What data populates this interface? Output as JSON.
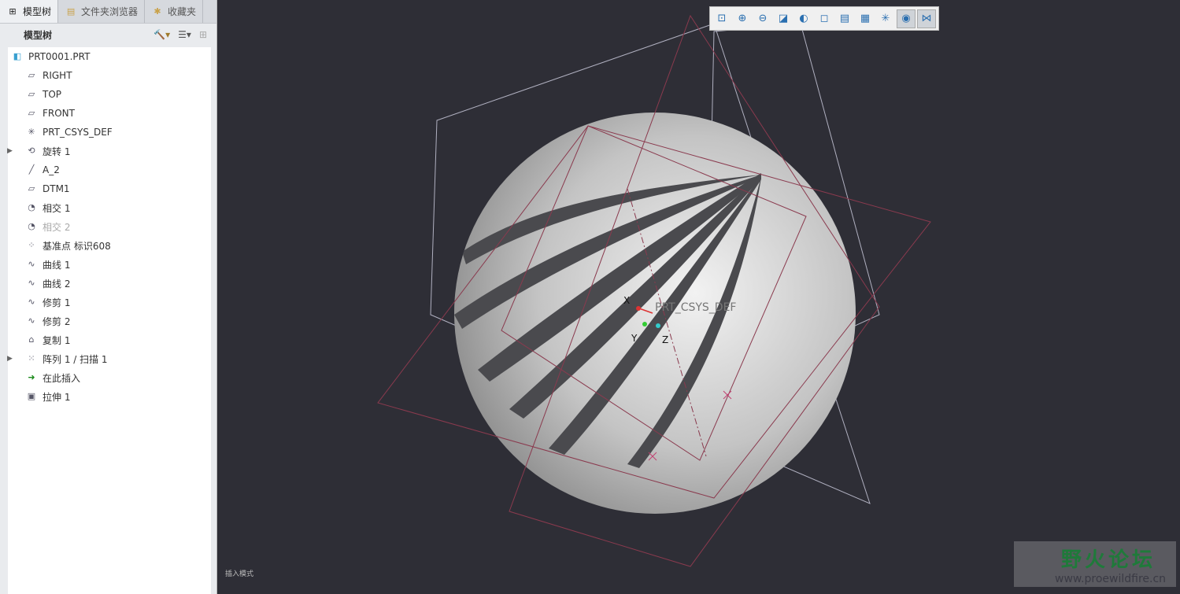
{
  "tabs": [
    {
      "label": "模型树",
      "icon": "model-tree-icon"
    },
    {
      "label": "文件夹浏览器",
      "icon": "folder-icon"
    },
    {
      "label": "收藏夹",
      "icon": "favorites-icon"
    }
  ],
  "panel_title": "模型树",
  "tree": [
    {
      "label": "PRT0001.PRT",
      "icon": "part-icon"
    },
    {
      "label": "RIGHT",
      "icon": "datum-plane-icon"
    },
    {
      "label": "TOP",
      "icon": "datum-plane-icon"
    },
    {
      "label": "FRONT",
      "icon": "datum-plane-icon"
    },
    {
      "label": "PRT_CSYS_DEF",
      "icon": "csys-icon"
    },
    {
      "label": "旋转 1",
      "icon": "revolve-icon",
      "expandable": true
    },
    {
      "label": "A_2",
      "icon": "axis-icon"
    },
    {
      "label": "DTM1",
      "icon": "datum-plane-icon"
    },
    {
      "label": "相交 1",
      "icon": "intersect-icon"
    },
    {
      "label": "相交 2",
      "icon": "intersect-icon",
      "dim": true
    },
    {
      "label": "基准点 标识608",
      "icon": "datum-point-icon"
    },
    {
      "label": "曲线 1",
      "icon": "curve-icon"
    },
    {
      "label": "曲线 2",
      "icon": "curve-icon"
    },
    {
      "label": "修剪 1",
      "icon": "trim-icon"
    },
    {
      "label": "修剪 2",
      "icon": "trim-icon"
    },
    {
      "label": "复制 1",
      "icon": "copy-icon"
    },
    {
      "label": "阵列 1 / 扫描 1",
      "icon": "pattern-icon",
      "expandable": true
    },
    {
      "label": "在此插入",
      "icon": "insert-here-icon"
    },
    {
      "label": "拉伸 1",
      "icon": "extrude-icon"
    }
  ],
  "viewport": {
    "csys_label": "PRT_CSYS_DEF",
    "axis_x": "X",
    "axis_y": "Y",
    "axis_z": "Z",
    "mode_text": "插入模式",
    "toolbar": [
      "refit-icon",
      "zoom-in-icon",
      "zoom-out-icon",
      "repaint-icon",
      "display-style-icon",
      "saved-views-icon",
      "named-view-icon",
      "view-manager-icon",
      "datum-display-icon",
      "spin-center-icon",
      "annotation-display-icon"
    ]
  },
  "watermark": {
    "name": "野火论坛",
    "url": "www.proewildfire.cn"
  }
}
